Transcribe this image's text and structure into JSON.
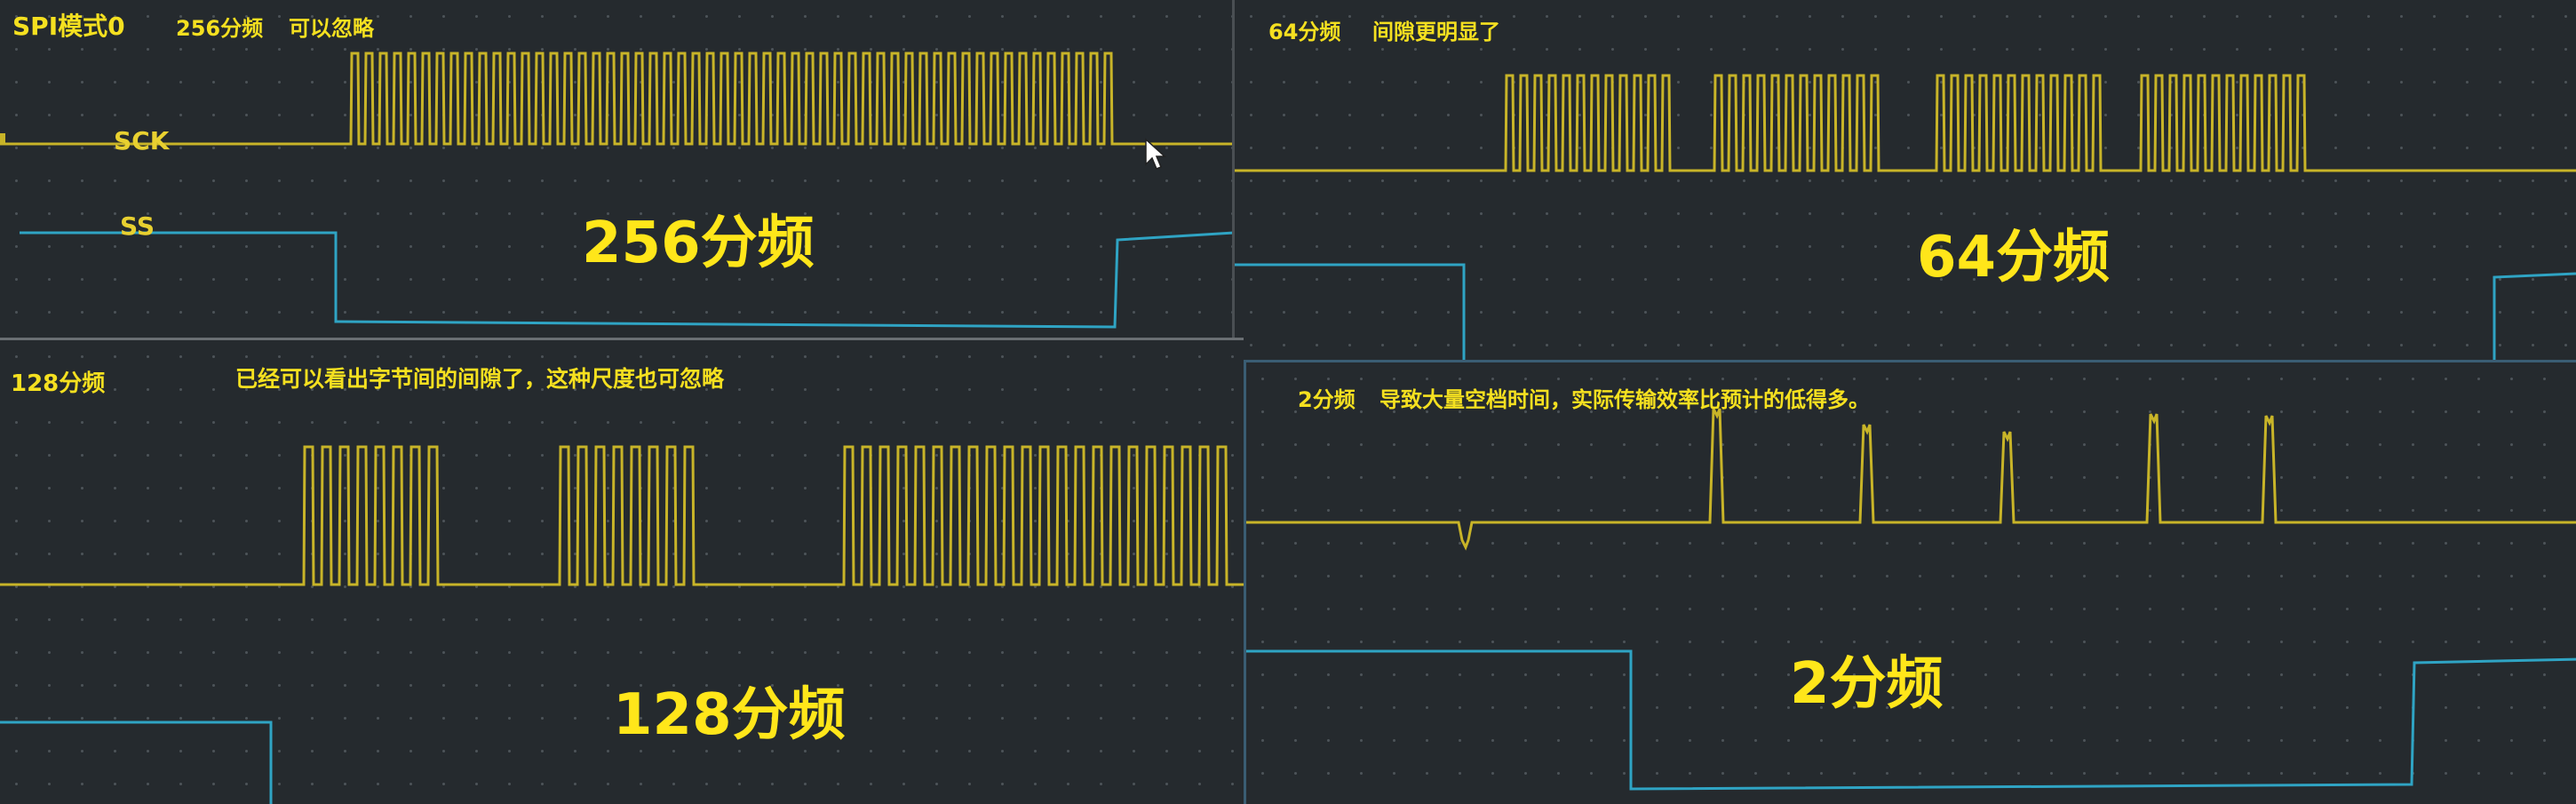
{
  "colors": {
    "sck": "#c8b428",
    "ss": "#2fa4c4",
    "label": "#f5e020"
  },
  "panel_256": {
    "mode_label": "SPI模式0",
    "divider_label": "256分频",
    "note": "可以忽略",
    "sck_label": "SCK",
    "ss_label": "SS",
    "big_label": "256分频"
  },
  "panel_64": {
    "divider_label": "64分频",
    "note": "间隙更明显了",
    "big_label": "64分频"
  },
  "panel_128": {
    "divider_label": "128分频",
    "note": "已经可以看出字节间的间隙了，这种尺度也可忽略",
    "big_label": "128分频"
  },
  "panel_2": {
    "divider_label": "2分频",
    "note": "导致大量空档时间，实际传输效率比预计的低得多。",
    "big_label": "2分频"
  }
}
